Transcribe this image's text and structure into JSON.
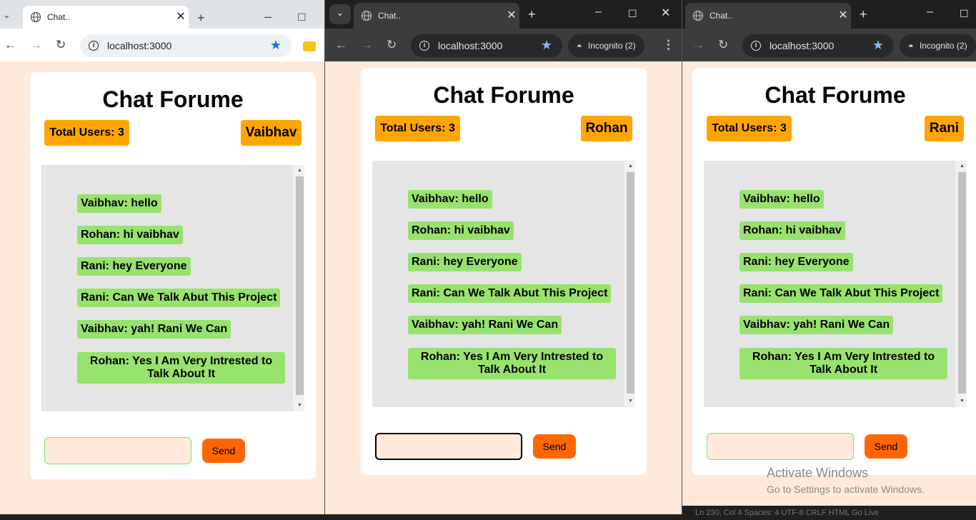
{
  "windows": [
    {
      "tab_title": "Chat..",
      "url": "localhost:3000",
      "incognito_label": "",
      "header_title": "Chat Forume",
      "total_users": "Total Users: 3",
      "username": "Vaibhav",
      "send_label": "Send"
    },
    {
      "tab_title": "Chat..",
      "url": "localhost:3000",
      "incognito_label": "Incognito (2)",
      "header_title": "Chat Forume",
      "total_users": "Total Users: 3",
      "username": "Rohan",
      "send_label": "Send"
    },
    {
      "tab_title": "Chat..",
      "url": "localhost:3000",
      "incognito_label": "Incognito (2)",
      "header_title": "Chat Forume",
      "total_users": "Total Users: 3",
      "username": "Rani",
      "send_label": "Send"
    }
  ],
  "messages": [
    "Vaibhav: hello",
    "Rohan: hi vaibhav",
    "Rani: hey Everyone",
    "Rani: Can We Talk Abut This Project",
    "Vaibhav: yah! Rani We Can",
    "Rohan: Yes I Am Very Intrested to Talk About It"
  ],
  "activation": {
    "title": "Activate Windows",
    "subtitle": "Go to Settings to activate Windows."
  },
  "status_bar": "Ln 230, Col 4   Spaces: 4   UTF-8   CRLF   HTML   Go Live"
}
